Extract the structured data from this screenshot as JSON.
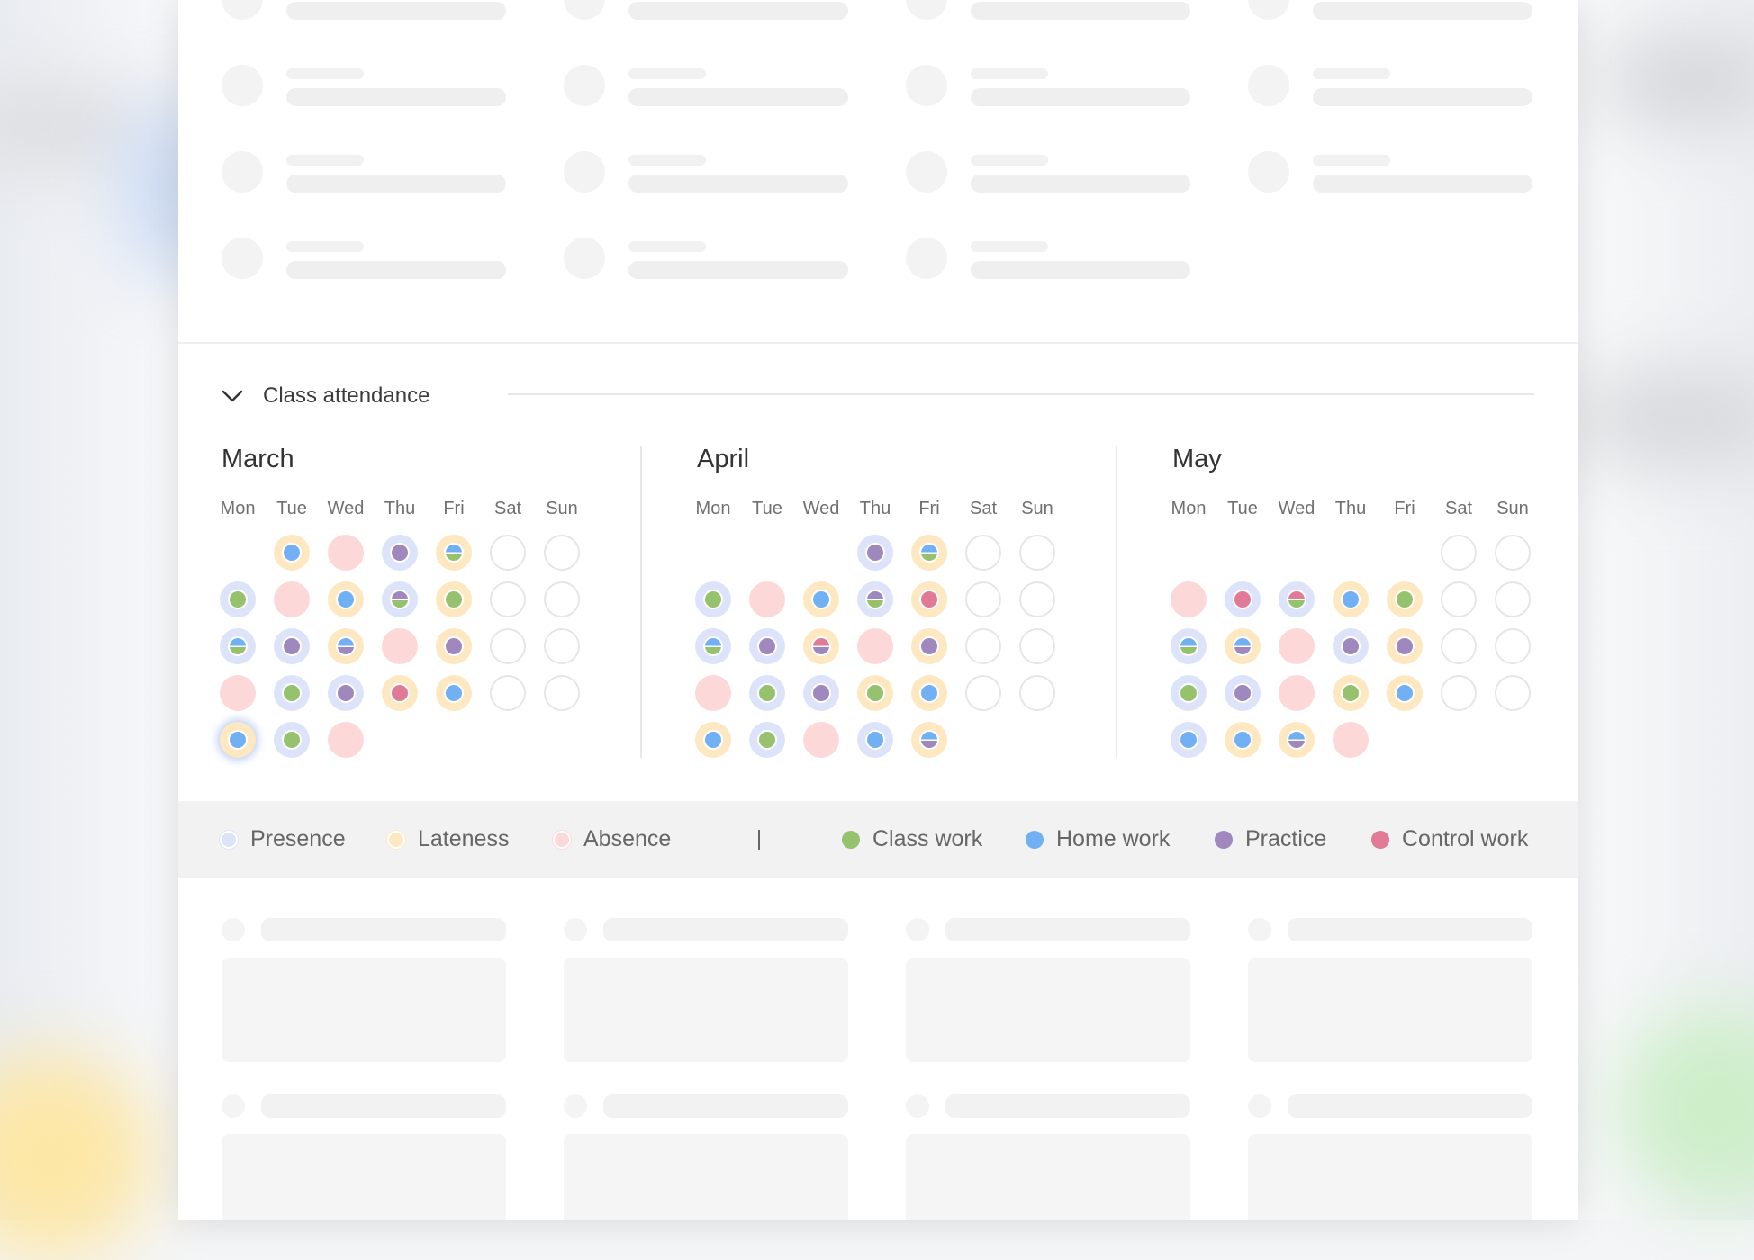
{
  "section": {
    "title": "Class attendance"
  },
  "weekdays": [
    "Mon",
    "Tue",
    "Wed",
    "Thu",
    "Fri",
    "Sat",
    "Sun"
  ],
  "colors": {
    "presence": "#dde4fa",
    "lateness": "#fde8c2",
    "absence": "#fdd8d9",
    "class_work": "#96c26e",
    "home_work": "#71b1f3",
    "practice": "#9f88bd",
    "control_work": "#e07a97",
    "empty_border": "#e6e6e6"
  },
  "months": [
    {
      "name": "March",
      "weeks": [
        [
          null,
          {
            "att": "lateness",
            "work": [
              "home_work"
            ]
          },
          {
            "att": "absence",
            "work": []
          },
          {
            "att": "presence",
            "work": [
              "practice"
            ]
          },
          {
            "att": "lateness",
            "work": [
              "home_work",
              "class_work"
            ]
          },
          {
            "att": "empty",
            "work": []
          },
          {
            "att": "empty",
            "work": []
          }
        ],
        [
          {
            "att": "presence",
            "work": [
              "class_work"
            ]
          },
          {
            "att": "absence",
            "work": []
          },
          {
            "att": "lateness",
            "work": [
              "home_work"
            ]
          },
          {
            "att": "presence",
            "work": [
              "practice",
              "class_work"
            ]
          },
          {
            "att": "lateness",
            "work": [
              "class_work"
            ]
          },
          {
            "att": "empty",
            "work": []
          },
          {
            "att": "empty",
            "work": []
          }
        ],
        [
          {
            "att": "presence",
            "work": [
              "home_work",
              "class_work"
            ]
          },
          {
            "att": "presence",
            "work": [
              "practice"
            ]
          },
          {
            "att": "lateness",
            "work": [
              "home_work",
              "practice"
            ]
          },
          {
            "att": "absence",
            "work": []
          },
          {
            "att": "lateness",
            "work": [
              "practice"
            ]
          },
          {
            "att": "empty",
            "work": []
          },
          {
            "att": "empty",
            "work": []
          }
        ],
        [
          {
            "att": "absence",
            "work": []
          },
          {
            "att": "presence",
            "work": [
              "class_work"
            ]
          },
          {
            "att": "presence",
            "work": [
              "practice"
            ]
          },
          {
            "att": "lateness",
            "work": [
              "control_work"
            ]
          },
          {
            "att": "lateness",
            "work": [
              "home_work"
            ]
          },
          {
            "att": "empty",
            "work": []
          },
          {
            "att": "empty",
            "work": []
          }
        ],
        [
          {
            "att": "lateness",
            "work": [
              "home_work"
            ],
            "highlight": true
          },
          {
            "att": "presence",
            "work": [
              "class_work"
            ]
          },
          {
            "att": "absence",
            "work": []
          },
          null,
          null,
          null,
          null
        ]
      ]
    },
    {
      "name": "April",
      "weeks": [
        [
          null,
          null,
          null,
          {
            "att": "presence",
            "work": [
              "practice"
            ]
          },
          {
            "att": "lateness",
            "work": [
              "home_work",
              "class_work"
            ]
          },
          {
            "att": "empty",
            "work": []
          },
          {
            "att": "empty",
            "work": []
          }
        ],
        [
          {
            "att": "presence",
            "work": [
              "class_work"
            ]
          },
          {
            "att": "absence",
            "work": []
          },
          {
            "att": "lateness",
            "work": [
              "home_work"
            ]
          },
          {
            "att": "presence",
            "work": [
              "practice",
              "class_work"
            ]
          },
          {
            "att": "lateness",
            "work": [
              "control_work"
            ]
          },
          {
            "att": "empty",
            "work": []
          },
          {
            "att": "empty",
            "work": []
          }
        ],
        [
          {
            "att": "presence",
            "work": [
              "home_work",
              "class_work"
            ]
          },
          {
            "att": "presence",
            "work": [
              "practice"
            ]
          },
          {
            "att": "lateness",
            "work": [
              "control_work",
              "practice"
            ]
          },
          {
            "att": "absence",
            "work": []
          },
          {
            "att": "lateness",
            "work": [
              "practice"
            ]
          },
          {
            "att": "empty",
            "work": []
          },
          {
            "att": "empty",
            "work": []
          }
        ],
        [
          {
            "att": "absence",
            "work": []
          },
          {
            "att": "presence",
            "work": [
              "class_work"
            ]
          },
          {
            "att": "presence",
            "work": [
              "practice"
            ]
          },
          {
            "att": "lateness",
            "work": [
              "class_work"
            ]
          },
          {
            "att": "lateness",
            "work": [
              "home_work"
            ]
          },
          {
            "att": "empty",
            "work": []
          },
          {
            "att": "empty",
            "work": []
          }
        ],
        [
          {
            "att": "lateness",
            "work": [
              "home_work"
            ]
          },
          {
            "att": "presence",
            "work": [
              "class_work"
            ]
          },
          {
            "att": "absence",
            "work": []
          },
          {
            "att": "presence",
            "work": [
              "home_work"
            ]
          },
          {
            "att": "lateness",
            "work": [
              "home_work",
              "practice"
            ]
          },
          null,
          null
        ]
      ]
    },
    {
      "name": "May",
      "weeks": [
        [
          null,
          null,
          null,
          null,
          null,
          {
            "att": "empty",
            "work": []
          },
          {
            "att": "empty",
            "work": []
          }
        ],
        [
          {
            "att": "absence",
            "work": []
          },
          {
            "att": "presence",
            "work": [
              "control_work"
            ]
          },
          {
            "att": "presence",
            "work": [
              "control_work",
              "class_work"
            ]
          },
          {
            "att": "lateness",
            "work": [
              "home_work"
            ]
          },
          {
            "att": "lateness",
            "work": [
              "class_work"
            ]
          },
          {
            "att": "empty",
            "work": []
          },
          {
            "att": "empty",
            "work": []
          }
        ],
        [
          {
            "att": "presence",
            "work": [
              "home_work",
              "class_work"
            ]
          },
          {
            "att": "lateness",
            "work": [
              "home_work",
              "practice"
            ]
          },
          {
            "att": "absence",
            "work": []
          },
          {
            "att": "presence",
            "work": [
              "practice"
            ]
          },
          {
            "att": "lateness",
            "work": [
              "practice"
            ]
          },
          {
            "att": "empty",
            "work": []
          },
          {
            "att": "empty",
            "work": []
          }
        ],
        [
          {
            "att": "presence",
            "work": [
              "class_work"
            ]
          },
          {
            "att": "presence",
            "work": [
              "practice"
            ]
          },
          {
            "att": "absence",
            "work": []
          },
          {
            "att": "lateness",
            "work": [
              "class_work"
            ]
          },
          {
            "att": "lateness",
            "work": [
              "home_work"
            ]
          },
          {
            "att": "empty",
            "work": []
          },
          {
            "att": "empty",
            "work": []
          }
        ],
        [
          {
            "att": "presence",
            "work": [
              "home_work"
            ]
          },
          {
            "att": "lateness",
            "work": [
              "home_work"
            ]
          },
          {
            "att": "lateness",
            "work": [
              "home_work",
              "practice"
            ]
          },
          {
            "att": "absence",
            "work": []
          },
          null,
          null,
          null
        ]
      ]
    }
  ],
  "legend": {
    "attendance": [
      {
        "key": "presence",
        "label": "Presence"
      },
      {
        "key": "lateness",
        "label": "Lateness"
      },
      {
        "key": "absence",
        "label": "Absence"
      }
    ],
    "separator": "|",
    "work": [
      {
        "key": "class_work",
        "label": "Class work"
      },
      {
        "key": "home_work",
        "label": "Home work"
      },
      {
        "key": "practice",
        "label": "Practice"
      },
      {
        "key": "control_work",
        "label": "Control work"
      }
    ]
  }
}
